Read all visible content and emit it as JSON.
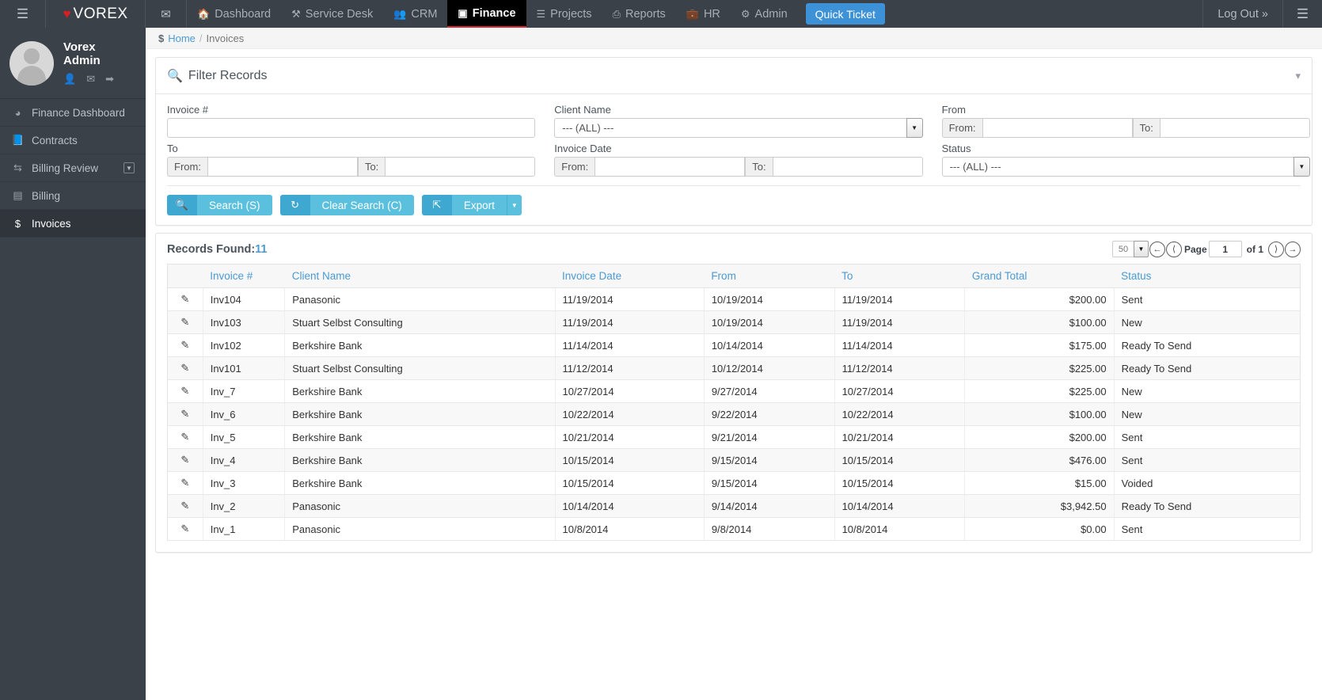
{
  "topnav": {
    "burger_icon": "hamburger-icon",
    "logo_text": "VOREX",
    "mail_icon": "envelope-icon",
    "items": [
      {
        "label": "Dashboard",
        "icon": "home-icon",
        "active": false
      },
      {
        "label": "Service Desk",
        "icon": "wrench-icon",
        "active": false
      },
      {
        "label": "CRM",
        "icon": "users-icon",
        "active": false
      },
      {
        "label": "Finance",
        "icon": "money-icon",
        "active": true
      },
      {
        "label": "Projects",
        "icon": "tasks-icon",
        "active": false
      },
      {
        "label": "Reports",
        "icon": "print-icon",
        "active": false
      },
      {
        "label": "HR",
        "icon": "briefcase-icon",
        "active": false
      },
      {
        "label": "Admin",
        "icon": "gear-icon",
        "active": false
      }
    ],
    "quick_ticket": "Quick Ticket",
    "logout": "Log Out »",
    "accent_active": "#e1272d",
    "quick_ticket_color": "#3d91d6"
  },
  "sidebar": {
    "user_name": "Vorex Admin",
    "user_icons": [
      "user-icon",
      "envelope-icon",
      "signout-icon"
    ],
    "items": [
      {
        "label": "Finance Dashboard",
        "icon": "dashboard-icon",
        "active": false,
        "caret": false
      },
      {
        "label": "Contracts",
        "icon": "book-icon",
        "active": false,
        "caret": false
      },
      {
        "label": "Billing Review",
        "icon": "exchange-icon",
        "active": false,
        "caret": true
      },
      {
        "label": "Billing",
        "icon": "money-bill-icon",
        "active": false,
        "caret": false
      },
      {
        "label": "Invoices",
        "icon": "dollar-icon",
        "active": true,
        "caret": false
      }
    ]
  },
  "breadcrumb": {
    "dollar_icon": "dollar-icon",
    "home": "Home",
    "separator": "/",
    "current": "Invoices"
  },
  "filter": {
    "title": "Filter Records",
    "search_icon": "search-icon",
    "collapse_icon": "chevron-down-icon",
    "fields": {
      "invoice_number": {
        "label": "Invoice #",
        "value": "",
        "placeholder": ""
      },
      "client_name": {
        "label": "Client Name",
        "selected": "--- (ALL) ---"
      },
      "from": {
        "label": "From",
        "from_addon": "From:",
        "from_value": "",
        "to_addon": "To:",
        "to_value": ""
      },
      "to": {
        "label": "To",
        "from_addon": "From:",
        "from_value": "",
        "to_addon": "To:",
        "to_value": ""
      },
      "invoice_date": {
        "label": "Invoice Date",
        "from_addon": "From:",
        "from_value": "",
        "to_addon": "To:",
        "to_value": ""
      },
      "status": {
        "label": "Status",
        "selected": "--- (ALL) ---"
      }
    },
    "buttons": {
      "search": {
        "label": "Search (S)",
        "icon": "search-icon"
      },
      "clear": {
        "label": "Clear Search (C)",
        "icon": "refresh-icon"
      },
      "export": {
        "label": "Export",
        "icon": "export-icon",
        "caret": "caret-down-icon"
      }
    }
  },
  "results": {
    "records_found_label": "Records Found:",
    "records_found_count": "11",
    "pager": {
      "page_size": "50",
      "first_icon": "arrow-first-icon",
      "prev_icon": "chevron-left-icon",
      "page_label": "Page",
      "page_value": "1",
      "of_label": "of 1",
      "next_icon": "chevron-right-icon",
      "last_icon": "arrow-last-icon"
    },
    "columns": [
      "",
      "Invoice #",
      "Client Name",
      "Invoice Date",
      "From",
      "To",
      "Grand Total",
      "Status"
    ],
    "rows": [
      {
        "edit": "edit-icon",
        "invoice": "Inv104",
        "client": "Panasonic",
        "invoice_date": "11/19/2014",
        "from": "10/19/2014",
        "to": "11/19/2014",
        "grand_total": "$200.00",
        "status": "Sent"
      },
      {
        "edit": "edit-icon",
        "invoice": "Inv103",
        "client": "Stuart Selbst Consulting",
        "invoice_date": "11/19/2014",
        "from": "10/19/2014",
        "to": "11/19/2014",
        "grand_total": "$100.00",
        "status": "New"
      },
      {
        "edit": "edit-icon",
        "invoice": "Inv102",
        "client": "Berkshire Bank",
        "invoice_date": "11/14/2014",
        "from": "10/14/2014",
        "to": "11/14/2014",
        "grand_total": "$175.00",
        "status": "Ready To Send"
      },
      {
        "edit": "edit-icon",
        "invoice": "Inv101",
        "client": "Stuart Selbst Consulting",
        "invoice_date": "11/12/2014",
        "from": "10/12/2014",
        "to": "11/12/2014",
        "grand_total": "$225.00",
        "status": "Ready To Send"
      },
      {
        "edit": "edit-icon",
        "invoice": "Inv_7",
        "client": "Berkshire Bank",
        "invoice_date": "10/27/2014",
        "from": "9/27/2014",
        "to": "10/27/2014",
        "grand_total": "$225.00",
        "status": "New"
      },
      {
        "edit": "edit-icon",
        "invoice": "Inv_6",
        "client": "Berkshire Bank",
        "invoice_date": "10/22/2014",
        "from": "9/22/2014",
        "to": "10/22/2014",
        "grand_total": "$100.00",
        "status": "New"
      },
      {
        "edit": "edit-icon",
        "invoice": "Inv_5",
        "client": "Berkshire Bank",
        "invoice_date": "10/21/2014",
        "from": "9/21/2014",
        "to": "10/21/2014",
        "grand_total": "$200.00",
        "status": "Sent"
      },
      {
        "edit": "edit-icon",
        "invoice": "Inv_4",
        "client": "Berkshire Bank",
        "invoice_date": "10/15/2014",
        "from": "9/15/2014",
        "to": "10/15/2014",
        "grand_total": "$476.00",
        "status": "Sent"
      },
      {
        "edit": "edit-icon",
        "invoice": "Inv_3",
        "client": "Berkshire Bank",
        "invoice_date": "10/15/2014",
        "from": "9/15/2014",
        "to": "10/15/2014",
        "grand_total": "$15.00",
        "status": "Voided"
      },
      {
        "edit": "edit-icon",
        "invoice": "Inv_2",
        "client": "Panasonic",
        "invoice_date": "10/14/2014",
        "from": "9/14/2014",
        "to": "10/14/2014",
        "grand_total": "$3,942.50",
        "status": "Ready To Send"
      },
      {
        "edit": "edit-icon",
        "invoice": "Inv_1",
        "client": "Panasonic",
        "invoice_date": "10/8/2014",
        "from": "9/8/2014",
        "to": "10/8/2014",
        "grand_total": "$0.00",
        "status": "Sent"
      }
    ]
  }
}
